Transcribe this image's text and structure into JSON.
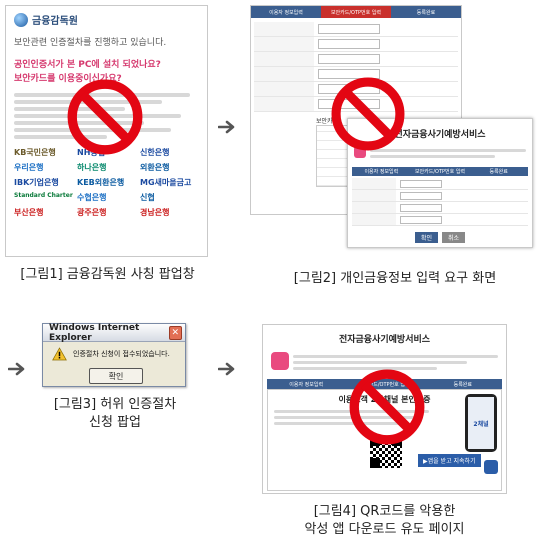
{
  "captions": {
    "fig1": "[그림1] 금융감독원 사칭 팝업창",
    "fig2": "[그림2] 개인금융정보 입력 요구 화면",
    "fig3_line1": "[그림3] 허위 인증절차",
    "fig3_line2": "신청 팝업",
    "fig4_line1": "[그림4] QR코드를 악용한",
    "fig4_line2": "악성 앱 다운로드 유도 페이지"
  },
  "fig1": {
    "org_name": "금융감독원",
    "headline": "보안관련 인증절차를 진행하고 있습니다.",
    "question_line1": "공인인증서가 본 PC에 설치 되었나요?",
    "question_line2": "보안카드를 이용중이신가요?",
    "banks": [
      "KB국민은행",
      "NH농협",
      "신한은행",
      "우리은행",
      "하나은행",
      "외환은행",
      "IBK기업은행",
      "KEB외환은행",
      "MG새마을금고",
      "Standard Chartered",
      "수협은행",
      "신협",
      "부산은행",
      "광주은행",
      "경남은행"
    ]
  },
  "fig2": {
    "steps": [
      "이용자 정보입력",
      "보안카드/OTP번호 입력",
      "등록완료"
    ],
    "section_label": "보안카드",
    "popup_title": "전자금융사기예방서비스",
    "confirm_label": "확인",
    "cancel_label": "취소"
  },
  "fig3": {
    "window_title": "Windows Internet Explorer",
    "close_glyph": "✕",
    "message": "인증절차 신청이 접수되었습니다.",
    "ok_label": "확인"
  },
  "fig4": {
    "title": "전자금융사기예방서비스",
    "steps": [
      "이용자 정보입력",
      "보안카드/OTP번호 입력",
      "등록완료"
    ],
    "banner": "이용고객 2차채널 본인인증",
    "app_label": "2채널",
    "download_label": "▶앱을 받고 지속하기"
  },
  "colors": {
    "prohibit": "#e30613",
    "arrow": "#555555",
    "fss_blue": "#2d4f7c",
    "question_pink": "#d63a6f"
  }
}
